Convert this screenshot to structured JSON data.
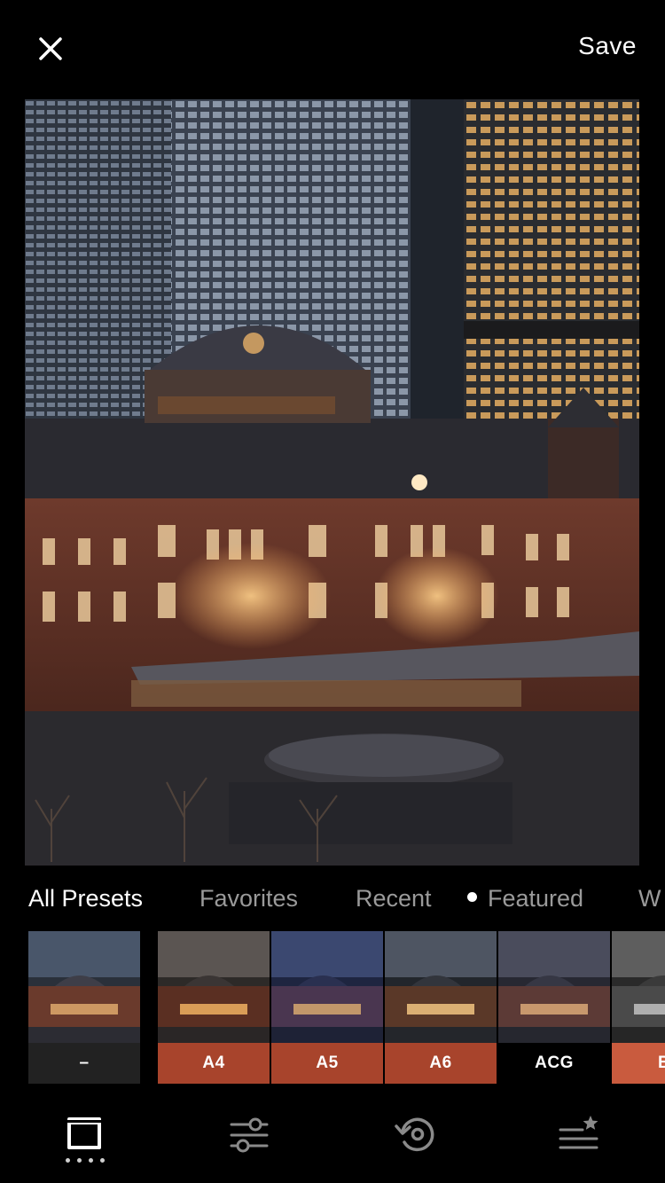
{
  "header": {
    "close_icon": "close-icon",
    "save_label": "Save"
  },
  "photo": {
    "subject": "photo-thumbnail"
  },
  "tabs": [
    {
      "label": "All Presets",
      "active": true,
      "dot": false
    },
    {
      "label": "Favorites",
      "active": false,
      "dot": false
    },
    {
      "label": "Recent",
      "active": false,
      "dot": false
    },
    {
      "label": "Featured",
      "active": false,
      "dot": true
    },
    {
      "label": "W",
      "active": false,
      "dot": false
    }
  ],
  "presets": [
    {
      "label": "–",
      "color": "#222222"
    },
    {
      "label": "A4",
      "color": "#a8442c"
    },
    {
      "label": "A5",
      "color": "#a8442c"
    },
    {
      "label": "A6",
      "color": "#a8442c"
    },
    {
      "label": "ACG",
      "color": "#000000"
    },
    {
      "label": "B",
      "color": "#c95b3e"
    }
  ],
  "toolbar": {
    "items": [
      "presets-icon",
      "adjust-sliders-icon",
      "history-icon",
      "favorites-icon"
    ],
    "active_index": 0
  }
}
